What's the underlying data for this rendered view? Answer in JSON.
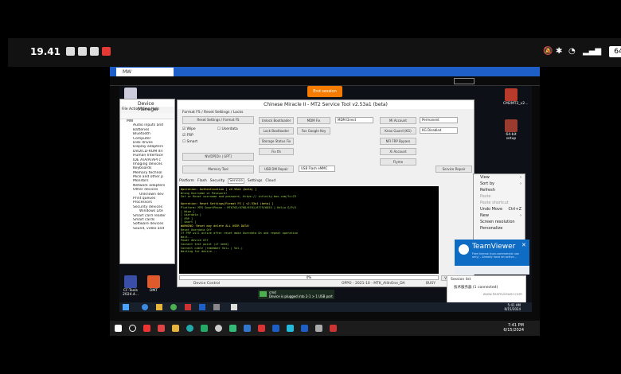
{
  "phone_status": {
    "time": "19.41",
    "battery": "64",
    "notif_icons": [
      "whatsapp-icon",
      "messages-icon",
      "messenger-icon",
      "youtube-icon"
    ],
    "status_icons": [
      "mute-icon",
      "bluetooth-icon",
      "wifi-icon",
      "signal-icon"
    ]
  },
  "teamviewer": {
    "tab_label": "MW",
    "end_session": "End session",
    "panel_title": "TeamViewer",
    "panel_sub": "Free license (non-commercial use only) - Already have an active...",
    "session_list_label": "Session list",
    "session_entry": "技术服务器  (1 connected)",
    "watermark": "www.teamviewer.com"
  },
  "device_manager": {
    "title": "Device Manager",
    "menu": [
      "File",
      "Action",
      "View",
      "Help"
    ],
    "tree": [
      "MW",
      "Audio inputs and",
      "Batteries",
      "Bluetooth",
      "Computer",
      "Disk drives",
      "Display adapters",
      "DVD/CD-ROM dri",
      "Human Interface",
      "IDE ATA/ATAPI c",
      "Imaging devices",
      "Keyboards",
      "Memory technol",
      "Mice and other p",
      "Monitors",
      "Network adapters",
      "Other devices",
      "Unknown dev",
      "Print queues",
      "Processors",
      "Security devices",
      "Windows Lite",
      "Smart card reader",
      "Smart cards",
      "Software devices",
      "Sound, video and"
    ]
  },
  "tool": {
    "title": "Chinese Miracle II - MT2 Service Tool v2.53a1 (beta)",
    "group_title": "Format FS / Reset Settings / Locks",
    "btn_reset": "Reset Settings / Format FS",
    "chk_wipe": "Wipe",
    "chk_frp": "FRP",
    "chk_smart": "Smart",
    "chk_userdata": "Userdata",
    "btn_nvram": "NV/DP[Dir | GPT]",
    "btn_memtool": "Memory Tool",
    "mid_buttons": [
      "Unlock Bootloader",
      "Lock Bootloader",
      "Storage Status Fix",
      "Fix tfs",
      "USB DM Repair"
    ],
    "mid_buttons2": [
      "MDM Fix",
      "Fox Google Key"
    ],
    "select_mdm": "MDM Direct",
    "select_emmc": "USB Flash eMMC",
    "right_buttons": [
      "Mi Account",
      "Knox Guard (KG)",
      "NFI FRP Bypass",
      "Xi Account",
      "Flyme"
    ],
    "select_perm": "Permanent",
    "select_kg": "KG Disabled",
    "btn_service": "Service Repair",
    "tabs": [
      "Platform",
      "Flash",
      "Security",
      "Service",
      "Settings",
      "Cloud"
    ],
    "console": [
      {
        "t": "Operation: Authentication [ v2.53a1 (beta) ]",
        "hl": true
      },
      {
        "t": "Wrong Username or Password!",
        "hl": false
      },
      {
        "t": "Set or Reset username and password, https://  infinity-box.com/?c=23",
        "hl": false
      },
      {
        "t": "",
        "hl": false
      },
      {
        "t": "Operation: Reset Settings/Format FS [ v2.53a1 (beta) ]",
        "hl": true
      },
      {
        "t": "Platform: MTK SmartPhone : MT6765/6768/6761/6779/6853 | Helio G/P/X",
        "hl": false
      },
      {
        "t": "  [ Wipe ]",
        "hl": false
      },
      {
        "t": "  [ Userdata ]",
        "hl": false
      },
      {
        "t": "  [ FRP ]",
        "hl": false
      },
      {
        "t": "  [ Smart ]",
        "hl": false
      },
      {
        "t": "WARNING: Reset may delete ALL USER DATA!",
        "hl": true
      },
      {
        "t": "Reset Userdata Off",
        "hl": false
      },
      {
        "t": "If FRP will active after reset make Userdata On and repeat operation",
        "hl": false
      },
      {
        "t": "Wait...",
        "hl": false
      },
      {
        "t": "  Power device Off",
        "hl": false
      },
      {
        "t": "  Connect test point (if need)",
        "hl": false
      },
      {
        "t": "  Connect cable (remember Vol+ | Vol-)",
        "hl": false
      },
      {
        "t": "Waiting for device...",
        "hl": false
      }
    ],
    "progress": "0%",
    "btn_view": "View",
    "btn_stop": "Stop",
    "status_left": "Device Control",
    "status_mid": "OPPO - 2021-10 - MTK_AllInOne_DA",
    "status_right": "BUSY"
  },
  "context_menu": {
    "items": [
      {
        "label": "View",
        "arrow": true,
        "dim": false
      },
      {
        "label": "Sort by",
        "arrow": true,
        "dim": false
      },
      {
        "label": "Refresh",
        "arrow": false,
        "dim": false
      },
      {
        "label": "Paste",
        "arrow": false,
        "dim": true
      },
      {
        "label": "Paste shortcut",
        "arrow": false,
        "dim": true
      },
      {
        "label": "Undo Move",
        "arrow": false,
        "dim": false,
        "shortcut": "Ctrl+Z"
      },
      {
        "label": "New",
        "arrow": true,
        "dim": false
      },
      {
        "label": "Screen resolution",
        "arrow": false,
        "dim": false
      },
      {
        "label": "Personalize",
        "arrow": false,
        "dim": false
      }
    ]
  },
  "desktop_icons": [
    {
      "label": "CM2MT2_v2...",
      "name": "cm2mt2-desktop-icon"
    },
    {
      "label": "64-bit setup",
      "name": "setup-desktop-icon"
    },
    {
      "label": "CF-Tools 2024.4...",
      "name": "cftools-desktop-icon"
    },
    {
      "label": "DMT",
      "name": "dmt-desktop-icon"
    }
  ],
  "usb_notice": "Device is plugged into 2-1 > 1 USB port",
  "usb_title": "cmd",
  "remote_clock": {
    "time": "5:41 AM",
    "date": "6/15/2024"
  },
  "host_clock": {
    "time": "7:41 PM",
    "date": "6/15/2024"
  },
  "colors": {
    "tv_blue": "#1d5ec7",
    "console_green": "#9ad34d",
    "console_yellow": "#e8e84a",
    "end_session": "#f57c00"
  }
}
